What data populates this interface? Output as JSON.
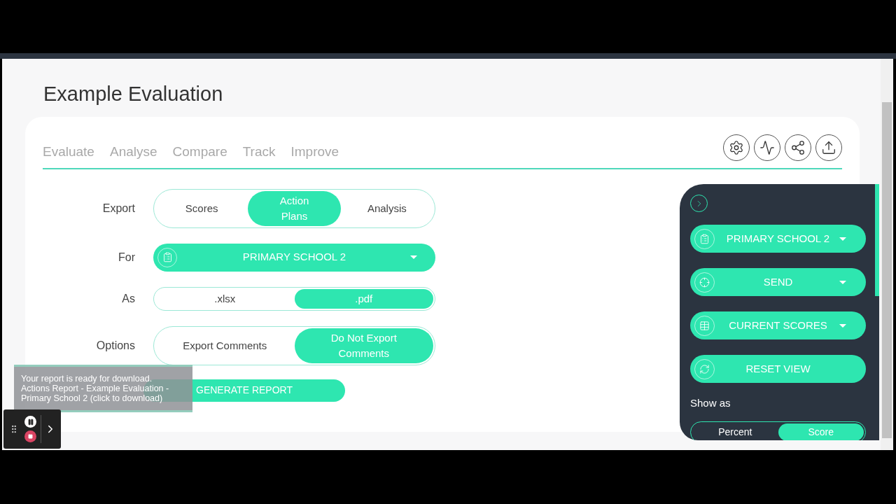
{
  "page": {
    "title": "Example Evaluation"
  },
  "tabs": [
    {
      "label": "Evaluate",
      "selected": false
    },
    {
      "label": "Analyse",
      "selected": false
    },
    {
      "label": "Compare",
      "selected": false
    },
    {
      "label": "Track",
      "selected": false
    },
    {
      "label": "Improve",
      "selected": false
    }
  ],
  "form": [
    {
      "label": "Export",
      "kind": "segmented",
      "options": [
        {
          "label": "Scores",
          "selected": false
        },
        {
          "label": "Action Plans",
          "selected": true
        },
        {
          "label": "Analysis",
          "selected": false
        }
      ]
    },
    {
      "label": "For",
      "kind": "dropdown",
      "value": "PRIMARY SCHOOL 2"
    },
    {
      "label": "As",
      "kind": "segmented",
      "options": [
        {
          "label": ".xlsx",
          "selected": false
        },
        {
          "label": ".pdf",
          "selected": true
        }
      ]
    },
    {
      "label": "Options",
      "kind": "segmented",
      "options": [
        {
          "label": "Export Comments",
          "selected": false
        },
        {
          "label": "Do Not Export Comments",
          "selected": true
        }
      ]
    }
  ],
  "generate_button": "GENERATE REPORT",
  "toast": {
    "message": "Your report is ready for download.",
    "link": "Actions Report - Example Evaluation - Primary School 2 (click to download)"
  },
  "side_panel": {
    "buttons": [
      {
        "label": "PRIMARY SCHOOL 2",
        "kind": "dropdown"
      },
      {
        "label": "SEND",
        "kind": "dropdown"
      },
      {
        "label": "CURRENT SCORES",
        "kind": "dropdown"
      },
      {
        "label": "RESET VIEW",
        "kind": "plain"
      }
    ],
    "show_as": "Show as",
    "options": [
      {
        "label": "Percent",
        "selected": false
      },
      {
        "label": "Score",
        "selected": true
      }
    ]
  }
}
